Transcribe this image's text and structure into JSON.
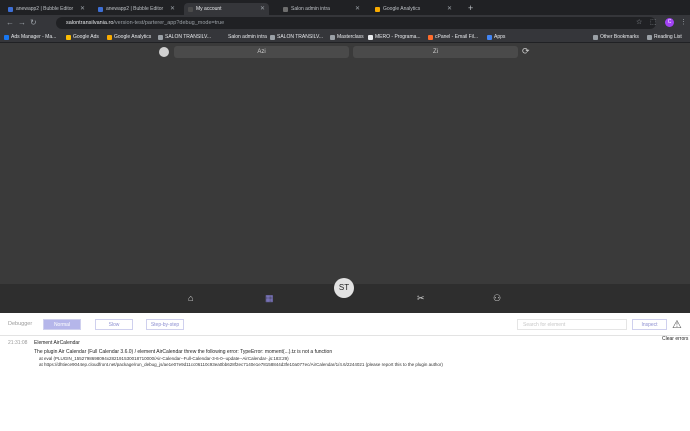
{
  "browser": {
    "tabs": [
      {
        "title": "anewapp2 | Bubble Editor",
        "fav": "#3d6fd6"
      },
      {
        "title": "anewapp2 | Bubble Editor",
        "fav": "#3d6fd6"
      },
      {
        "title": "My account",
        "fav": "#4a4a4a"
      },
      {
        "title": "Salon admin intra",
        "fav": "#6d6d6d"
      },
      {
        "title": "Google Analytics",
        "fav": "#f9ab00"
      }
    ],
    "url_host": "salontransilvania.ro",
    "url_path": "/version-test/parterer_app?debug_mode=true",
    "profile_initial": "C",
    "bookmarks": [
      "Ads Manager - Ma...",
      "Google Ads",
      "Google Analytics",
      "SALON TRANSILV...",
      "Salon admin intra",
      "SALON TRANSILV...",
      "Masterclass",
      "MERO - Programa...",
      "cPanel - Email Fil...",
      "Apps"
    ],
    "other_bookmarks": "Other Bookmarks",
    "reading_list": "Reading List"
  },
  "app": {
    "day_today": "Azi",
    "day_tomorrow": "Zi",
    "avatar_initials": "ST",
    "nav_icons": [
      "home-icon",
      "calendar-icon",
      "scissors-icon",
      "user-icon"
    ],
    "accent": "#8d86e0"
  },
  "debugger": {
    "label": "Debugger",
    "modes": [
      "Normal",
      "Slow",
      "Step-by-step"
    ],
    "inspect_placeholder": "Search for element",
    "inspect_label": "Inspect",
    "clear_label": "Clear errors",
    "log": {
      "time": "21:31:08",
      "element": "Element AirCalendar",
      "message": "The plugin Air Calendar (Full Calendar 3.6.0) / element AirCalendar threw the following error: TypeError: moment(...).tz is not a function",
      "line2": "at eval (PLUGIN_1552798698094x282191530018710000/Air-Calendar--Full-Calendar-3-6-0--update--AirCalendar-.js:183:29)",
      "line3": "at https://dhtiece9044ep.cloudfront.net/package/run_debug_js/ae1e07e9d11cc06110c93ea0bb628f2ec7140e1e78158844d3fe10a077ec/AirCalendar/1/4.6/2244021 (please report this to the plugin author)"
    }
  }
}
